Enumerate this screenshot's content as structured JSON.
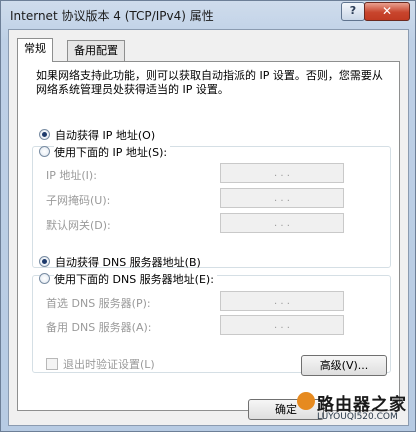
{
  "window": {
    "title": "Internet 协议版本 4 (TCP/IPv4) 属性",
    "help_glyph": "?",
    "close_glyph": "✕"
  },
  "tabs": [
    {
      "label": "常规",
      "active": true
    },
    {
      "label": "备用配置",
      "active": false
    }
  ],
  "description": "如果网络支持此功能，则可以获取自动指派的 IP 设置。否则，您需要从网络系统管理员处获得适当的 IP 设置。",
  "ip_section": {
    "auto_label": "自动获得 IP 地址(O)",
    "auto_selected": true,
    "manual_label": "使用下面的 IP 地址(S):",
    "manual_selected": false,
    "fields": [
      {
        "label": "IP 地址(I):",
        "value": ". . ."
      },
      {
        "label": "子网掩码(U):",
        "value": ". . ."
      },
      {
        "label": "默认网关(D):",
        "value": ". . ."
      }
    ]
  },
  "dns_section": {
    "auto_label": "自动获得 DNS 服务器地址(B)",
    "auto_selected": true,
    "manual_label": "使用下面的 DNS 服务器地址(E):",
    "manual_selected": false,
    "fields": [
      {
        "label": "首选 DNS 服务器(P):",
        "value": ". . ."
      },
      {
        "label": "备用 DNS 服务器(A):",
        "value": ". . ."
      }
    ]
  },
  "validate_checkbox": {
    "label": "退出时验证设置(L)",
    "checked": false,
    "enabled": false
  },
  "buttons": {
    "advanced": "高级(V)...",
    "ok": "确定"
  },
  "watermark": {
    "text": "路由器之家",
    "url": "LUYOUQI520.COM"
  }
}
